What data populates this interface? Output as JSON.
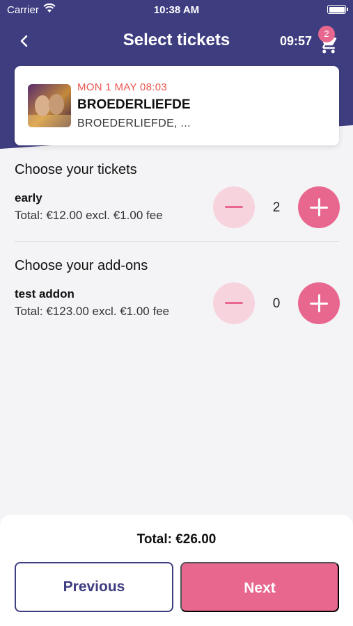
{
  "status_bar": {
    "carrier": "Carrier",
    "time": "10:38 AM"
  },
  "nav": {
    "title": "Select tickets",
    "timer": "09:57",
    "cart_badge": "2"
  },
  "event": {
    "date": "MON 1 MAY 08:03",
    "name": "BROEDERLIEFDE",
    "venue": "BROEDERLIEFDE, ..."
  },
  "tickets_section": {
    "title": "Choose your tickets",
    "items": [
      {
        "name": "early",
        "total": "Total: €12.00 excl. €1.00 fee",
        "quantity": "2"
      }
    ]
  },
  "addons_section": {
    "title": "Choose your add-ons",
    "items": [
      {
        "name": "test addon",
        "total": "Total: €123.00 excl. €1.00 fee",
        "quantity": "0"
      }
    ]
  },
  "footer": {
    "total": "Total: €26.00",
    "previous_label": "Previous",
    "next_label": "Next"
  },
  "colors": {
    "header": "#3e3d80",
    "accent": "#e8678f",
    "accent_light": "#f7d3de",
    "date": "#e8564f"
  },
  "icons": {
    "back": "chevron-left-icon",
    "cart": "cart-icon",
    "wifi": "wifi-icon",
    "battery": "battery-icon"
  }
}
